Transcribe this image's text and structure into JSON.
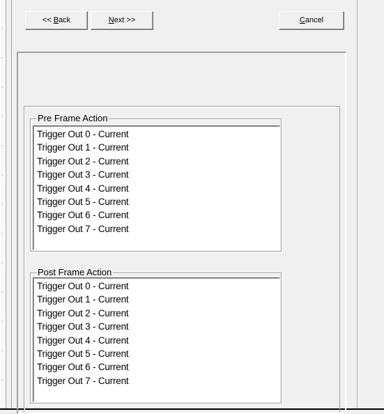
{
  "wizard": {
    "back_label": "<< Back",
    "back_prefix": "<< ",
    "back_hotkey": "B",
    "back_rest": "ack",
    "next_hotkey": "N",
    "next_rest": "ext >>",
    "cancel_hotkey": "C",
    "cancel_rest": "ancel"
  },
  "pre_frame": {
    "title": "Pre Frame Action",
    "items": [
      "Trigger Out 0 - Current",
      "Trigger Out 1 - Current",
      "Trigger Out 2 - Current",
      "Trigger Out 3 - Current",
      "Trigger Out 4 - Current",
      "Trigger Out 5 - Current",
      "Trigger Out 6 - Current",
      "Trigger Out 7 - Current"
    ]
  },
  "post_frame": {
    "title": "Post Frame Action",
    "items": [
      "Trigger Out 0 - Current",
      "Trigger Out 1 - Current",
      "Trigger Out 2 - Current",
      "Trigger Out 3 - Current",
      "Trigger Out 4 - Current",
      "Trigger Out 5 - Current",
      "Trigger Out 6 - Current",
      "Trigger Out 7 - Current"
    ]
  },
  "colors": {
    "face": "#f0f0f0",
    "shadow": "#a0a0a0",
    "dark_shadow": "#696969",
    "list_bg": "#ffffff"
  }
}
